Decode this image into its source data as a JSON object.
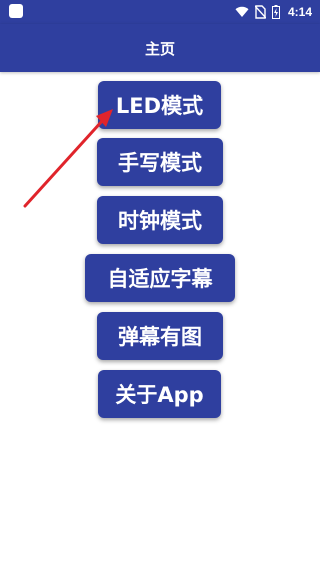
{
  "status_bar": {
    "time": "4:14",
    "icons": [
      "wifi-icon",
      "no-sim-icon",
      "battery-charging-icon"
    ]
  },
  "header": {
    "title": "主页"
  },
  "menu": {
    "items": [
      {
        "label": "LED模式"
      },
      {
        "label": "手写模式"
      },
      {
        "label": "时钟模式"
      },
      {
        "label": "自适应字幕"
      },
      {
        "label": "弹幕有图"
      },
      {
        "label": "关于App"
      }
    ]
  },
  "colors": {
    "primary": "#2f3f9f",
    "annotation_arrow": "#e0242b",
    "background": "#ffffff"
  }
}
